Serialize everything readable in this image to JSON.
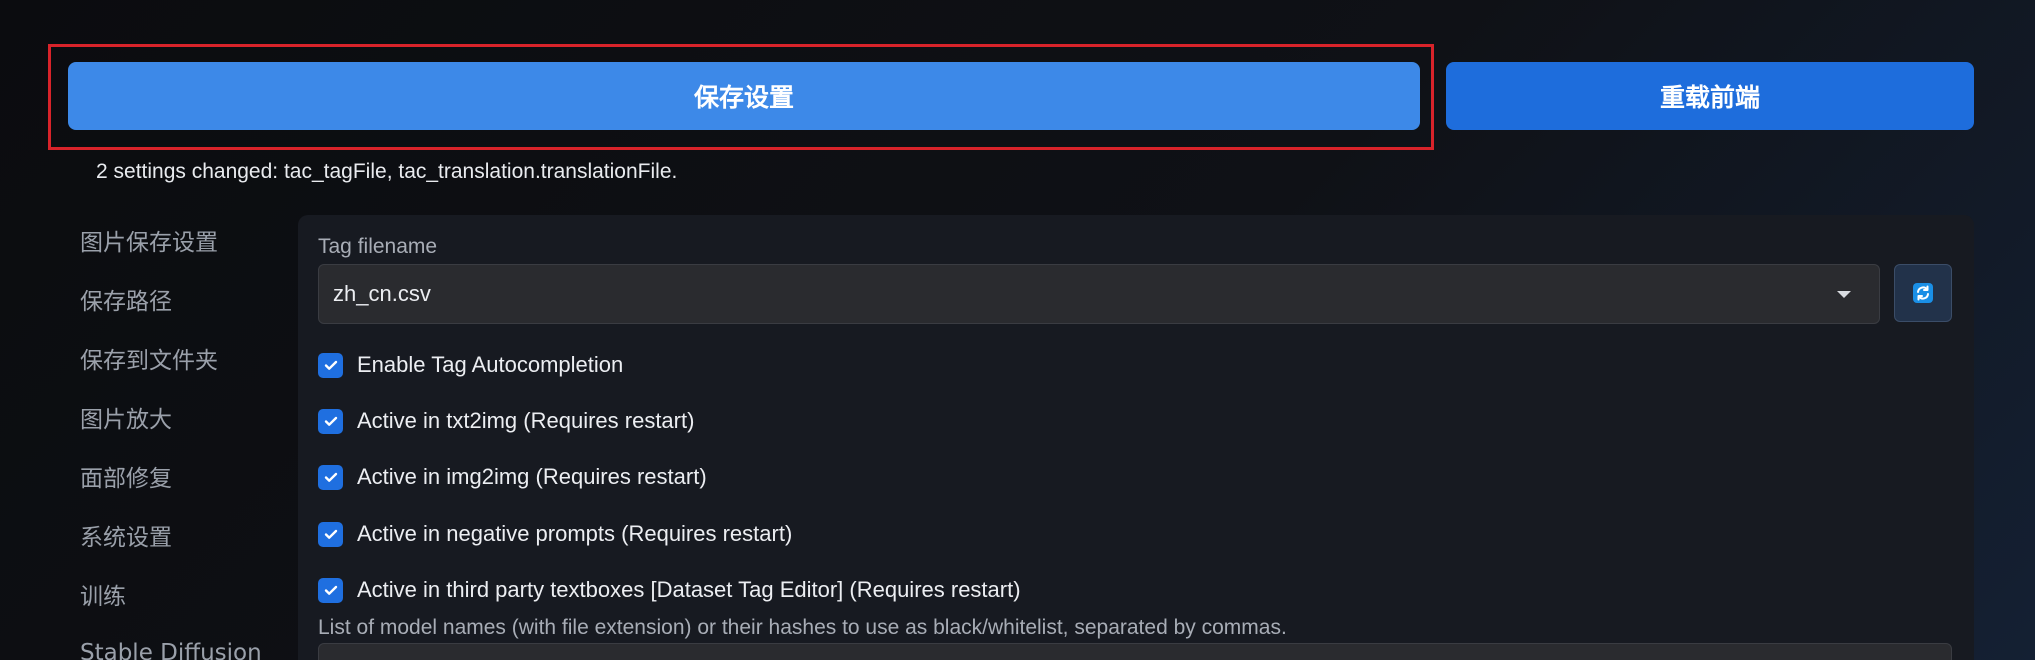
{
  "buttons": {
    "save_label": "保存设置",
    "reload_label": "重载前端"
  },
  "status": {
    "changed_note": "2 settings changed: tac_tagFile, tac_translation.translationFile."
  },
  "sidebar": {
    "items": [
      {
        "label": "图片保存设置"
      },
      {
        "label": "保存路径"
      },
      {
        "label": "保存到文件夹"
      },
      {
        "label": "图片放大"
      },
      {
        "label": "面部修复"
      },
      {
        "label": "系统设置"
      },
      {
        "label": "训练"
      },
      {
        "label": "Stable Diffusion"
      }
    ]
  },
  "settings": {
    "tag_filename_label": "Tag filename",
    "tag_filename_value": "zh_cn.csv",
    "refresh_icon": "refresh-icon",
    "checkboxes": [
      {
        "label": "Enable Tag Autocompletion",
        "checked": true
      },
      {
        "label": "Active in txt2img (Requires restart)",
        "checked": true
      },
      {
        "label": "Active in img2img (Requires restart)",
        "checked": true
      },
      {
        "label": "Active in negative prompts (Requires restart)",
        "checked": true
      },
      {
        "label": "Active in third party textboxes [Dataset Tag Editor] (Requires restart)",
        "checked": true
      }
    ],
    "model_list_label": "List of model names (with file extension) or their hashes to use as black/whitelist, separated by commas.",
    "model_list_value": ""
  },
  "colors": {
    "save_button": "#3d89e8",
    "reload_button": "#1e6ddc",
    "highlight": "#d8232a",
    "checkbox": "#1f6fe0"
  }
}
